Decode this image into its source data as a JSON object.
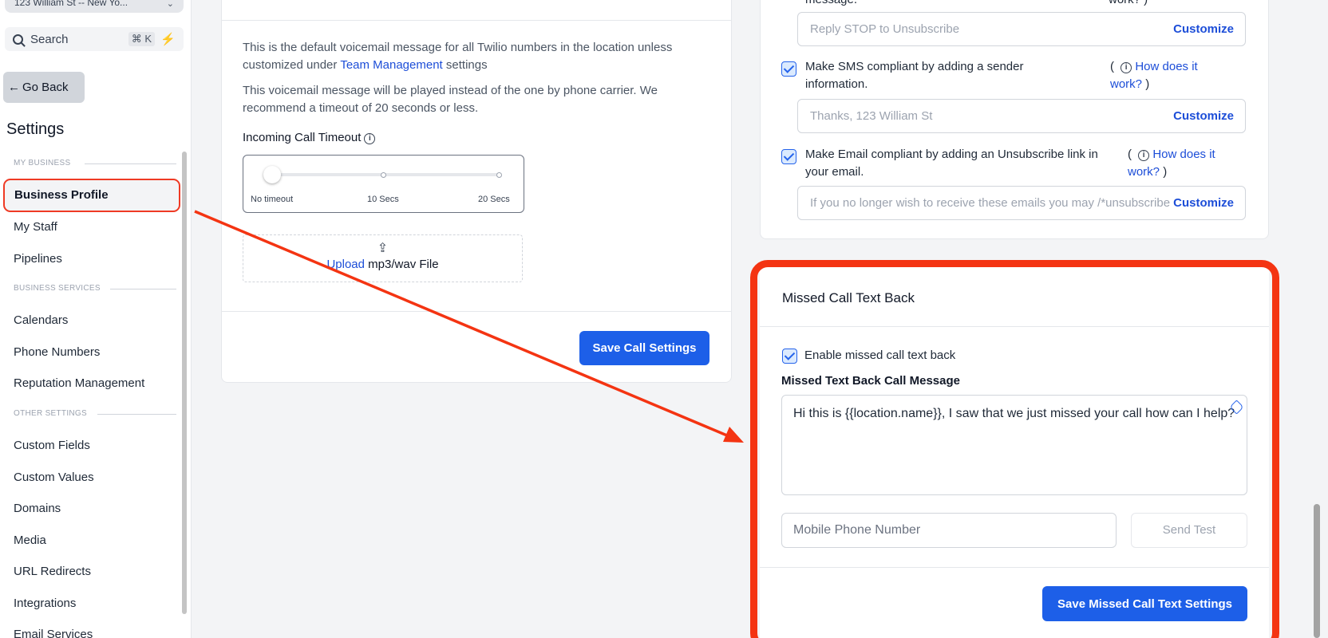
{
  "sidebar": {
    "location": "123 William St -- New Yo...",
    "search_label": "Search",
    "search_shortcut": "⌘ K",
    "go_back": "Go Back",
    "settings_title": "Settings",
    "sections": {
      "my_business": "MY BUSINESS",
      "business_services": "BUSINESS SERVICES",
      "other_settings": "OTHER SETTINGS"
    },
    "items": {
      "business_profile": "Business Profile",
      "my_staff": "My Staff",
      "pipelines": "Pipelines",
      "calendars": "Calendars",
      "phone_numbers": "Phone Numbers",
      "reputation_management": "Reputation Management",
      "custom_fields": "Custom Fields",
      "custom_values": "Custom Values",
      "domains": "Domains",
      "media": "Media",
      "url_redirects": "URL Redirects",
      "integrations": "Integrations",
      "email_services": "Email Services"
    }
  },
  "call_settings": {
    "voicemail_text_1": "This is the default voicemail message for all Twilio numbers in the location unless customized under",
    "team_management_link": "Team Management",
    "voicemail_text_1_end": "settings",
    "voicemail_text_2": "This voicemail message will be played instead of the one by phone carrier. We recommend a timeout of 20 seconds or less.",
    "timeout_label": "Incoming Call Timeout",
    "slider_labels": [
      "No timeout",
      "10 Secs",
      "20 Secs"
    ],
    "slider_value_fraction": 0,
    "upload_link": "Upload",
    "upload_text": "mp3/wav File",
    "save_button": "Save Call Settings"
  },
  "compliance": {
    "stop_partial": "message.",
    "stop_how_partial": "work? )",
    "stop_placeholder": "Reply STOP to Unsubscribe",
    "customize": "Customize",
    "sms_label": "Make SMS compliant by adding a sender information.",
    "sms_placeholder": "Thanks, 123 William St",
    "email_label": "Make Email compliant by adding an Unsubscribe link in your email.",
    "email_placeholder": "If you no longer wish to receive these emails you may /*unsubscribe*/",
    "how_open": "(",
    "how_link": "How does it work?",
    "how_close": ")"
  },
  "missed_call": {
    "title": "Missed Call Text Back",
    "enable_label": "Enable missed call text back",
    "message_label": "Missed Text Back Call Message",
    "message": "Hi this is {{location.name}}, I saw that we just missed your call how can I help?",
    "phone_placeholder": "Mobile Phone Number",
    "send_test": "Send Test",
    "save_button": "Save Missed Call Text Settings"
  },
  "colors": {
    "primary": "#1d5fe8",
    "highlight": "#f43412",
    "link": "#1d4ed8"
  }
}
